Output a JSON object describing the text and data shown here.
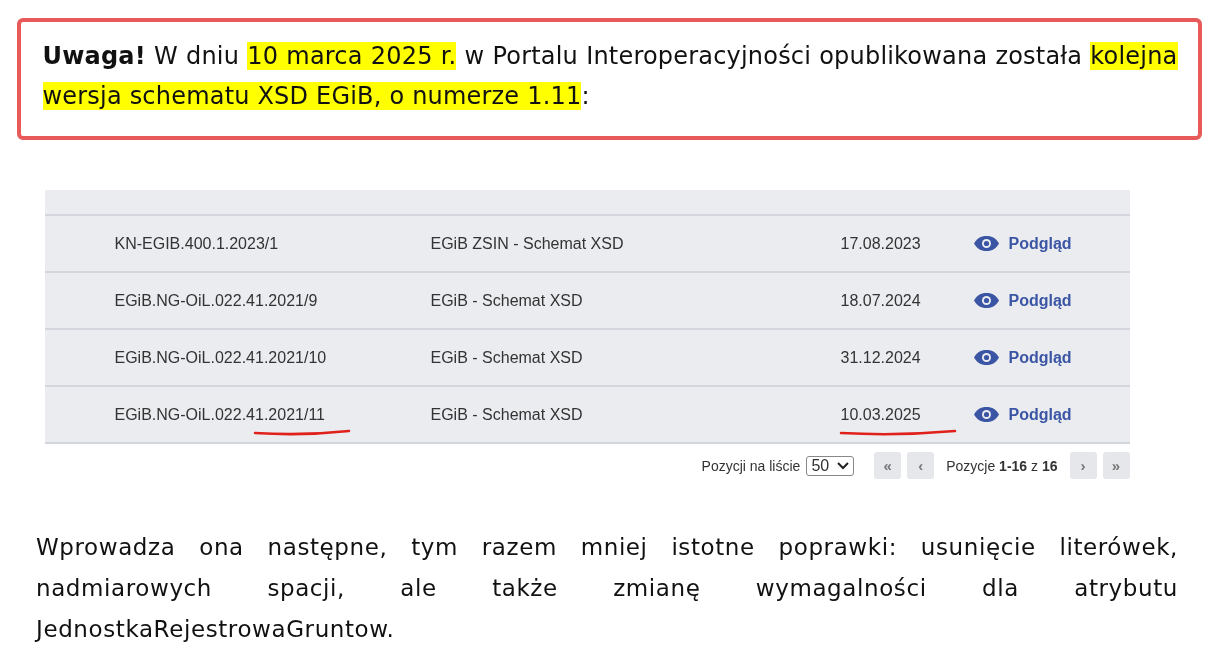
{
  "notice": {
    "segments": [
      {
        "text": "Uwaga!",
        "bold": true,
        "highlight": false
      },
      {
        "text": " W dniu ",
        "bold": false,
        "highlight": false
      },
      {
        "text": "10 marca 2025 r.",
        "bold": false,
        "highlight": true
      },
      {
        "text": " w Portalu Interoperacyjności opublikowana została ",
        "bold": false,
        "highlight": false
      },
      {
        "text": "kolejna wersja schematu XSD EGiB, o numerze 1.11",
        "bold": false,
        "highlight": true
      },
      {
        "text": ":",
        "bold": false,
        "highlight": false
      }
    ]
  },
  "table": {
    "rows": [
      {
        "sign": "KN-EGIB.400.1.2023/1",
        "name": "EGiB ZSIN - Schemat XSD",
        "date": "17.08.2023",
        "action": "Podgląd",
        "sign_underlined": false,
        "date_underlined": false
      },
      {
        "sign": "EGiB.NG-OiL.022.41.2021/9",
        "name": "EGiB - Schemat XSD",
        "date": "18.07.2024",
        "action": "Podgląd",
        "sign_underlined": false,
        "date_underlined": false
      },
      {
        "sign": "EGiB.NG-OiL.022.41.2021/10",
        "name": "EGiB - Schemat XSD",
        "date": "31.12.2024",
        "action": "Podgląd",
        "sign_underlined": false,
        "date_underlined": false
      },
      {
        "sign": "EGiB.NG-OiL.022.41.2021/11",
        "name": "EGiB - Schemat XSD",
        "date": "10.03.2025",
        "action": "Podgląd",
        "sign_underlined": true,
        "date_underlined": true
      }
    ]
  },
  "pagination": {
    "per_page_label": "Pozycji na liście",
    "per_page": "50",
    "first": "«",
    "prev": "‹",
    "range": "Pozycje **1-16** z **16**",
    "next": "›",
    "last": "»"
  },
  "paragraph": "Wprowadza ona następne, tym razem mniej istotne poprawki: usunięcie literówek, nadmiarowych spacji, ale także zmianę wymagalności dla atrybutu JednostkaRejestrowaGruntow."
}
